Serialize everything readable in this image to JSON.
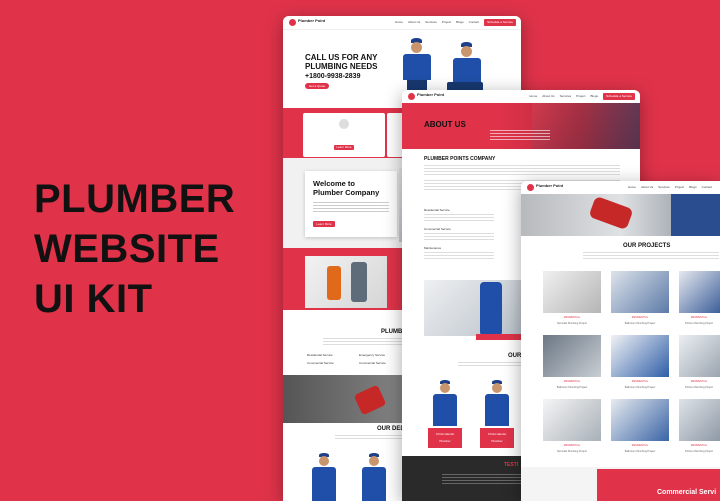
{
  "headline": [
    "PLUMBER",
    "WEBSITE",
    "UI KIT"
  ],
  "brand": {
    "name": "Plumber Point"
  },
  "nav": {
    "links": [
      "Home",
      "About Us",
      "Services",
      "Project",
      "Blogs",
      "Contact"
    ],
    "cta": "Schedule a Service"
  },
  "home": {
    "hero_title_1": "CALL US  FOR ANY",
    "hero_title_2": "PLUMBING NEEDS",
    "phone": "+1800-9938-2839",
    "hero_button": "Get a Quote",
    "welcome_title_1": "Welcome to",
    "welcome_title_2": "Plumber Company",
    "welcome_button": "Learn More",
    "learn_more": "Learn More",
    "services_title": "PLUMBER",
    "services_list": [
      "Residential Service",
      "Emergency Service",
      "Commercial Service",
      "Commercial Service"
    ],
    "team_title": "OUR DEDICA"
  },
  "about": {
    "title": "ABOUT US",
    "company_title": "PLUMBER POINTS COMPANY",
    "features": [
      "Residential Service",
      "Commercial Service",
      "Maintenance"
    ],
    "team_title": "OUR DEDI",
    "team": [
      {
        "name": "Christ Hamlet",
        "role": "Plumber"
      },
      {
        "name": "Christ Hamlet",
        "role": "Plumber"
      }
    ],
    "footer_title": "TESTI"
  },
  "projects": {
    "title": "OUR PROJECTS",
    "items": [
      {
        "category": "RESIDENTIAL",
        "name": "Remodel Plumbing Project"
      },
      {
        "category": "RESIDENTIAL",
        "name": "Bathroom Plumbing Project"
      },
      {
        "category": "RESIDENTIAL",
        "name": "Kitchen Plumbing Project"
      },
      {
        "category": "RESIDENTIAL",
        "name": "Bathroom Plumbing Project"
      },
      {
        "category": "RESIDENTIAL",
        "name": "Bathroom Plumbing Project"
      },
      {
        "category": "RESIDENTIAL",
        "name": "Kitchen Plumbing Project"
      },
      {
        "category": "RESIDENTIAL",
        "name": "Remodel Plumbing Project"
      },
      {
        "category": "RESIDENTIAL",
        "name": "Bathroom Plumbing Project"
      },
      {
        "category": "RESIDENTIAL",
        "name": "Kitchen Plumbing Project"
      }
    ],
    "banner": "Commercial Servi"
  },
  "colors": {
    "accent": "#e0334a",
    "dark": "#222222",
    "uniform": "#1f4fa8"
  }
}
